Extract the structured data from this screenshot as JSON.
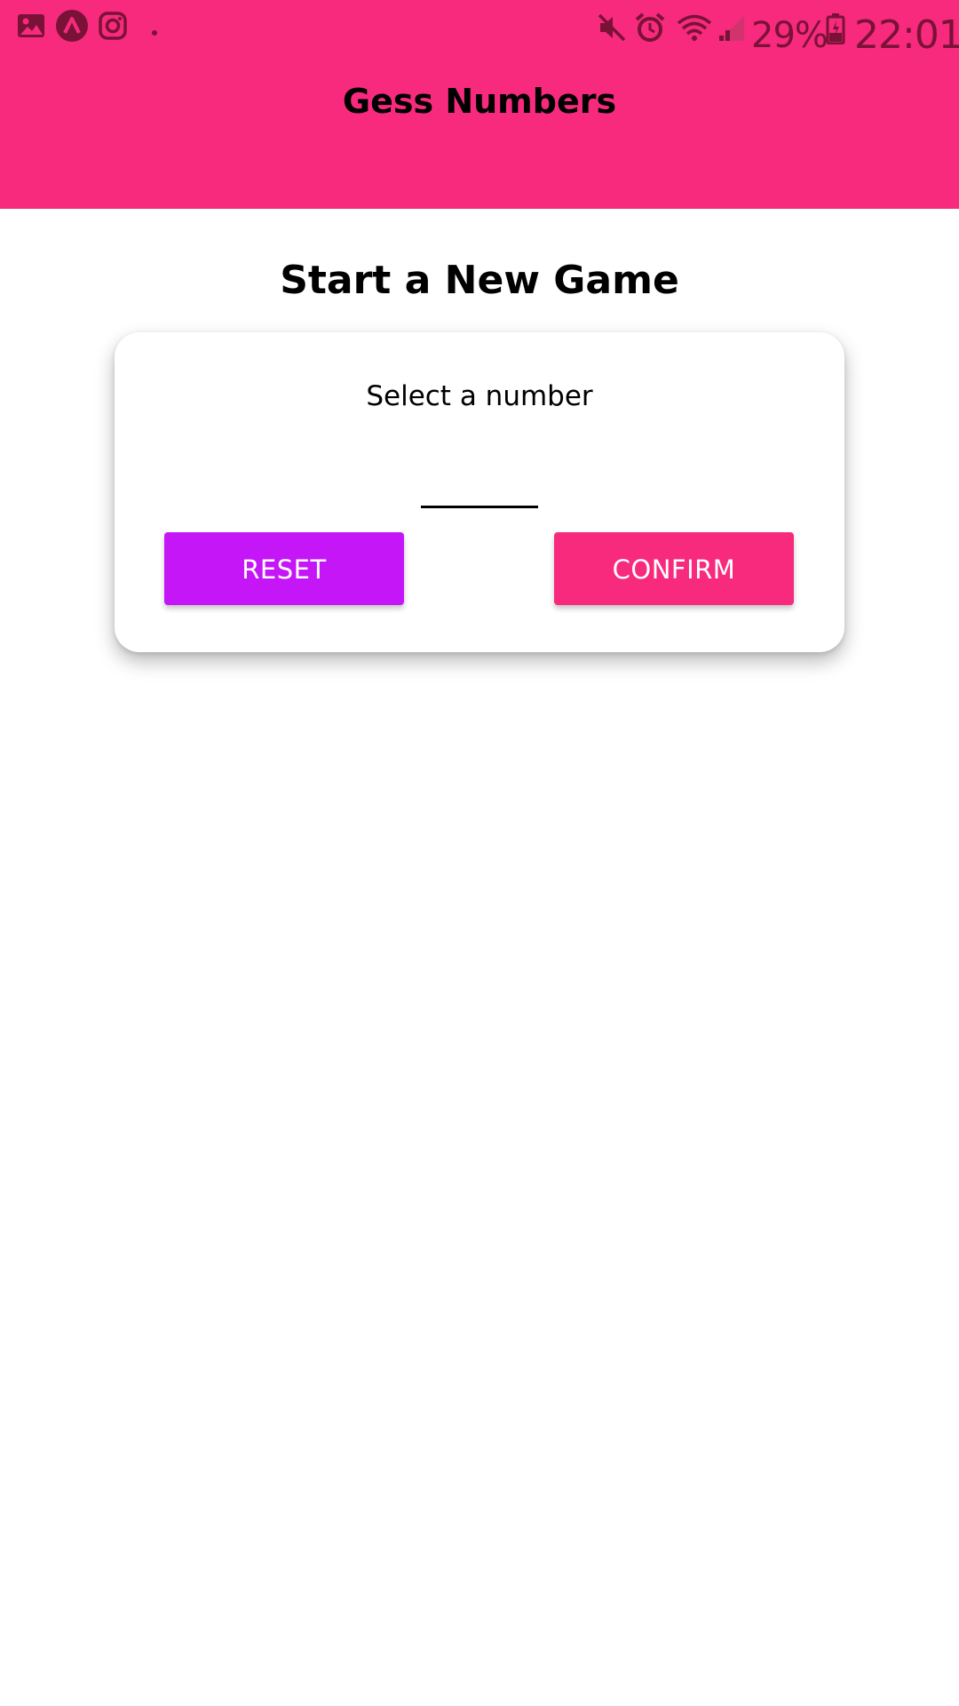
{
  "status_bar": {
    "battery": "29%",
    "time": "22:01",
    "icons_left": [
      "gallery-icon",
      "app-logo-icon",
      "instagram-icon",
      "dot-icon"
    ],
    "icons_right": [
      "mute-icon",
      "alarm-icon",
      "wifi-icon",
      "signal-icon",
      "battery-icon"
    ]
  },
  "header": {
    "title": "Gess Numbers",
    "background": "#f72a7d"
  },
  "main": {
    "title": "Start a New Game",
    "card": {
      "label": "Select a number",
      "input_value": "",
      "reset_label": "RESET",
      "confirm_label": "CONFIRM"
    }
  },
  "colors": {
    "accent": "#f72a7d",
    "secondary": "#c516f8"
  }
}
